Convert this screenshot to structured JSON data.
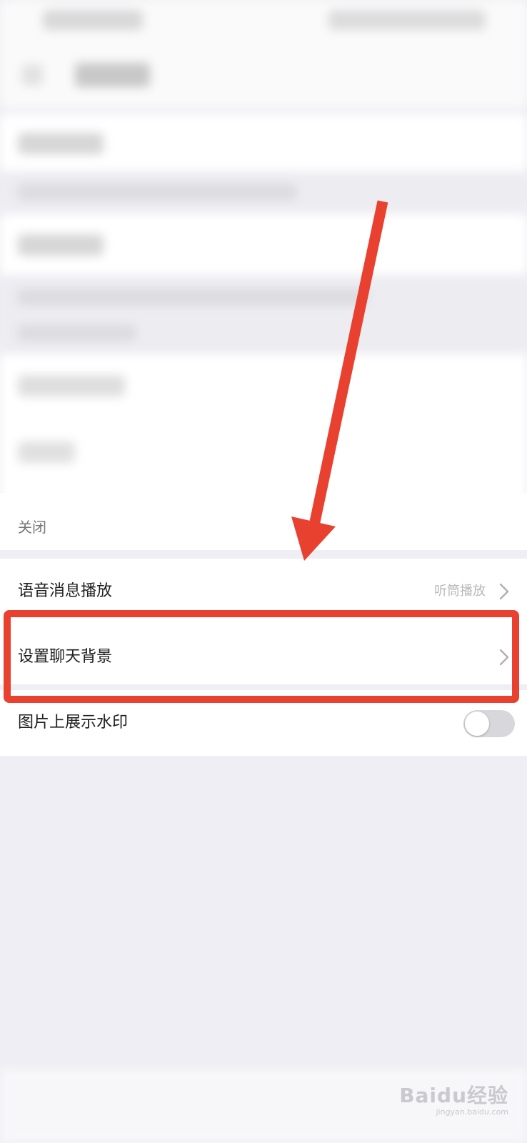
{
  "settings": {
    "close_label": "关闭",
    "rows": [
      {
        "label": "语音消息播放",
        "value": "听筒播放"
      },
      {
        "label": "设置聊天背景"
      },
      {
        "label": "图片上展示水印",
        "toggle_on": false
      }
    ]
  },
  "watermark": {
    "main": "Baidu经验",
    "sub": "jingyan.baidu.com"
  },
  "annotations": {
    "color": "#e8412f"
  }
}
